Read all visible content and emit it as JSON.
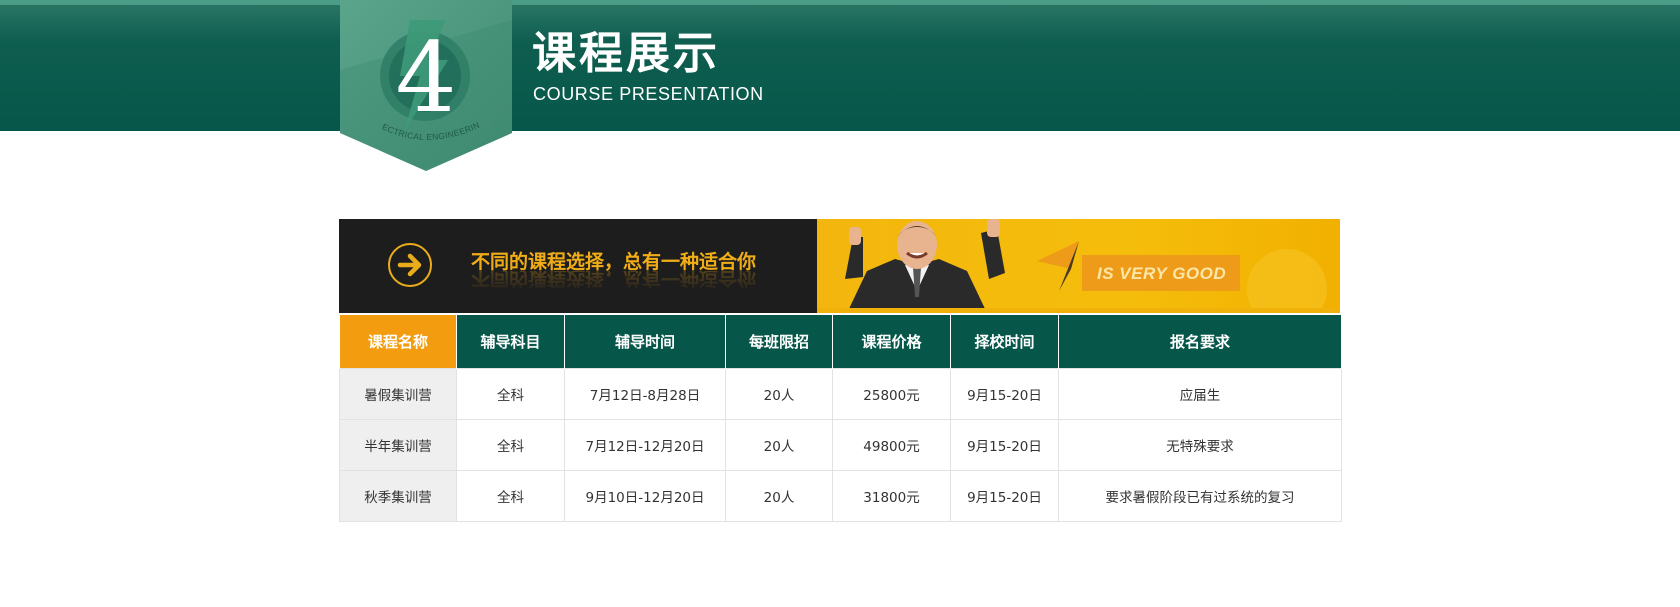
{
  "header": {
    "badge_number": "4",
    "badge_caption": "ELECTRICAL ENGINEERING",
    "title_cn": "课程展示",
    "title_en": "COURSE PRESENTATION"
  },
  "banner": {
    "promo_text": "不同的课程选择，总有一种适合你",
    "tagline": "IS VERY GOOD"
  },
  "table": {
    "headers": [
      "课程名称",
      "辅导科目",
      "辅导时间",
      "每班限招",
      "课程价格",
      "择校时间",
      "报名要求"
    ],
    "rows": [
      [
        "暑假集训营",
        "全科",
        "7月12日-8月28日",
        "20人",
        "25800元",
        "9月15-20日",
        "应届生"
      ],
      [
        "半年集训营",
        "全科",
        "7月12日-12月20日",
        "20人",
        "49800元",
        "9月15-20日",
        "无特殊要求"
      ],
      [
        "秋季集训营",
        "全科",
        "9月10日-12月20日",
        "20人",
        "31800元",
        "9月15-20日",
        "要求暑假阶段已有过系统的复习"
      ]
    ]
  },
  "colors": {
    "header_green": "#06574a",
    "accent_orange": "#f39c10",
    "promo_yellow": "#f0ad17"
  },
  "icons": {
    "badge": "lightning-bolt-icon",
    "banner_arrow": "arrow-right-icon"
  }
}
